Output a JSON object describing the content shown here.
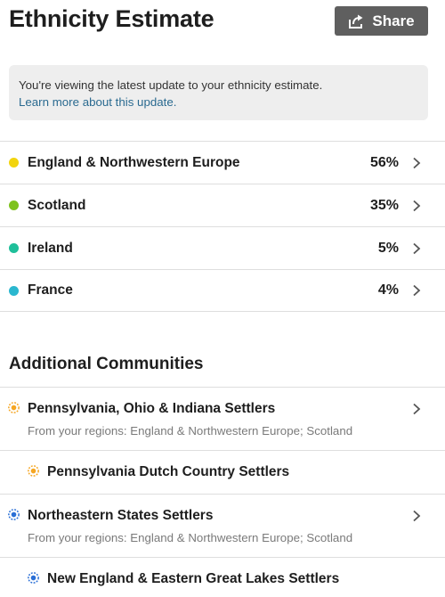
{
  "header": {
    "title": "Ethnicity Estimate",
    "share_label": "Share"
  },
  "notice": {
    "text": "You're viewing the latest update to your ethnicity estimate.",
    "link": "Learn more about this update."
  },
  "regions": [
    {
      "name": "England & Northwestern Europe",
      "percent": "56%",
      "color": "#f2d40e"
    },
    {
      "name": "Scotland",
      "percent": "35%",
      "color": "#7ec21d"
    },
    {
      "name": "Ireland",
      "percent": "5%",
      "color": "#1fbf9a"
    },
    {
      "name": "France",
      "percent": "4%",
      "color": "#2ab7cf"
    }
  ],
  "communities": {
    "section_title": "Additional Communities",
    "groups": [
      {
        "name": "Pennsylvania, Ohio & Indiana Settlers",
        "from": "From your regions: England & Northwestern Europe; Scotland",
        "color": "#f5a623",
        "sub": "Pennsylvania Dutch Country Settlers"
      },
      {
        "name": "Northeastern States Settlers",
        "from": "From your regions: England & Northwestern Europe; Scotland",
        "color": "#2a6fd6",
        "sub": "New England & Eastern Great Lakes Settlers"
      }
    ]
  },
  "icons": {
    "share": "share-icon",
    "chevron": "chevron-right-icon",
    "community": "community-dot-icon"
  }
}
